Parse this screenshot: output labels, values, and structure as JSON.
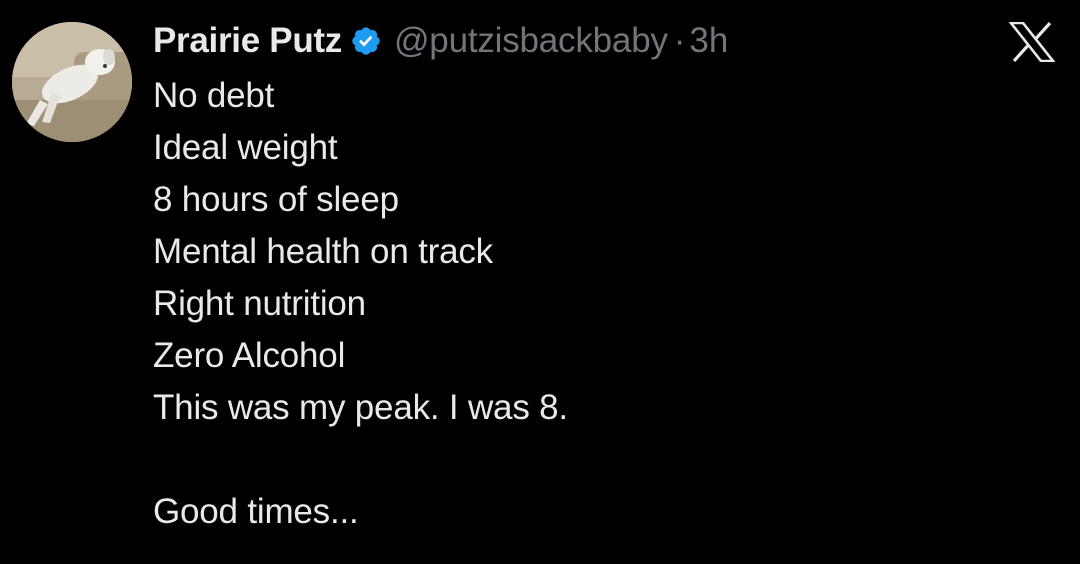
{
  "tweet": {
    "display_name": "Prairie Putz",
    "handle": "@putzisbackbaby",
    "separator": "·",
    "time": "3h",
    "lines": [
      "No debt",
      "Ideal weight",
      "8 hours of sleep",
      "Mental health on track",
      "Right nutrition",
      "Zero Alcohol",
      "This was my peak. I was 8.",
      "",
      "Good times..."
    ]
  },
  "icons": {
    "avatar": "dog-sleeping-avatar",
    "verified": "verified-badge-icon",
    "platform": "x-logo-icon"
  },
  "colors": {
    "background": "#000000",
    "text_primary": "#e7e9ea",
    "text_secondary": "#71767b",
    "verified_blue": "#1d9bf0"
  }
}
